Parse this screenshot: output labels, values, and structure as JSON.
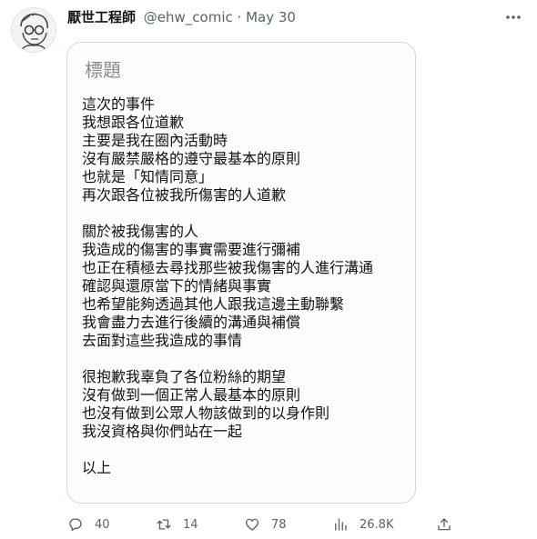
{
  "header": {
    "display_name": "厭世工程師",
    "handle": "@ehw_comic",
    "separator": "·",
    "date": "May 30"
  },
  "note": {
    "title": "標題",
    "paragraphs": [
      [
        "這次的事件",
        "我想跟各位道歉",
        "主要是我在圈內活動時",
        "沒有嚴禁嚴格的遵守最基本的原則",
        "也就是「知情同意」",
        "再次跟各位被我所傷害的人道歉"
      ],
      [
        "關於被我傷害的人",
        "我造成的傷害的事實需要進行彌補",
        "也正在積極去尋找那些被我傷害的人進行溝通",
        "確認與還原當下的情緒與事實",
        "也希望能夠透過其他人跟我這邊主動聯繫",
        "我會盡力去進行後續的溝通與補償",
        "去面對這些我造成的事情"
      ],
      [
        "很抱歉我辜負了各位粉絲的期望",
        "沒有做到一個正常人最基本的原則",
        "也沒有做到公眾人物該做到的以身作則",
        "我沒資格與你們站在一起"
      ],
      [
        "以上"
      ]
    ]
  },
  "actions": {
    "replies": "40",
    "retweets": "14",
    "likes": "78",
    "views": "26.8K"
  },
  "icons": {
    "avatar": "cartoon-avatar",
    "more": "more-icon",
    "reply": "reply-icon",
    "retweet": "retweet-icon",
    "like": "heart-icon",
    "views": "views-icon",
    "share": "share-icon"
  },
  "colors": {
    "text": "#0f1419",
    "muted": "#536471",
    "border": "#cfd9de"
  }
}
